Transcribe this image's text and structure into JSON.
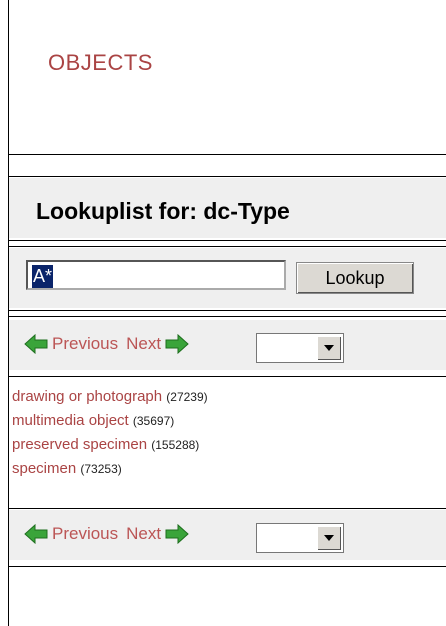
{
  "header": {
    "title": "OBJECTS"
  },
  "lookup": {
    "title": "Lookuplist for: dc-Type"
  },
  "search": {
    "value": "A*",
    "button_label": "Lookup"
  },
  "nav": {
    "previous_label": "Previous",
    "next_label": "Next",
    "select_value": ""
  },
  "results": [
    {
      "label": "drawing or photograph",
      "count": "(27239)"
    },
    {
      "label": "multimedia object",
      "count": "(35697)"
    },
    {
      "label": "preserved specimen",
      "count": "(155288)"
    },
    {
      "label": "specimen",
      "count": "(73253)"
    }
  ],
  "colors": {
    "link": "#b55",
    "title": "#a44",
    "panel": "#efefef",
    "arrow": "#2e9a2e"
  }
}
